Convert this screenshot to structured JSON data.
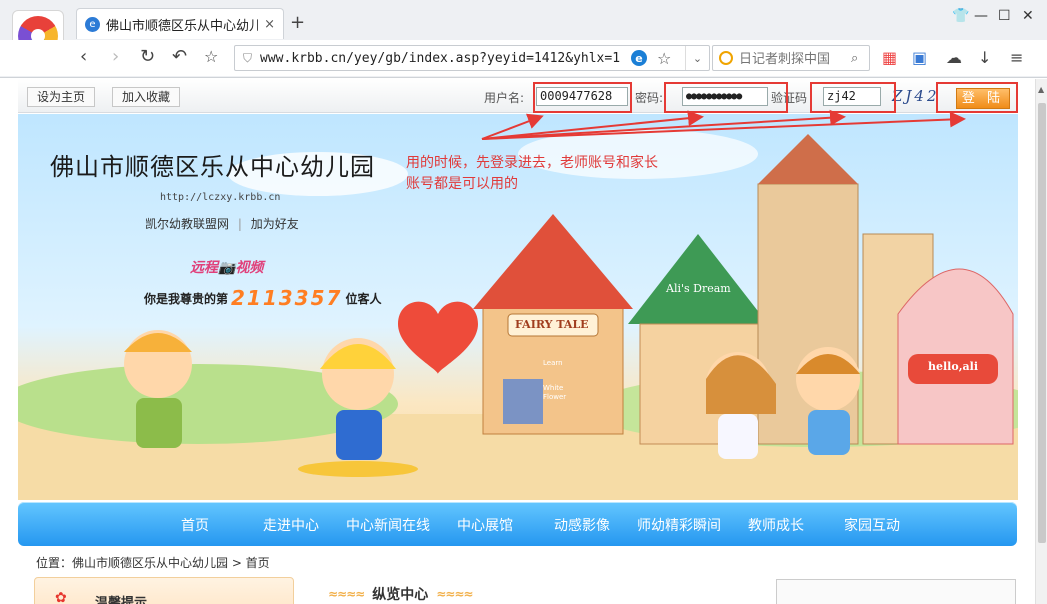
{
  "browser": {
    "tab_title": "佛山市顺德区乐从中心幼儿园",
    "tab_close": "×",
    "new_tab": "+",
    "url": "www.krbb.cn/yey/gb/index.asp?yeyid=1412&yhlx=1",
    "search_placeholder": "日记者刺探中国"
  },
  "topbar": {
    "set_home": "设为主页",
    "add_favorite": "加入收藏",
    "username_label": "用户名:",
    "username_value": "0009477628",
    "password_label": "密码:",
    "password_value": "●●●●●●●●●●●",
    "captcha_label": "验证码",
    "captcha_value": "zj42",
    "captcha_image_text": "ZJ42",
    "login_button": "登 陆"
  },
  "annotation": {
    "note": "用的时候，先登录进去，老师账号和家长账号都是可以用的"
  },
  "header": {
    "school_name": "佛山市顺德区乐从中心幼儿园",
    "school_url": "http://lczxy.krbb.cn",
    "link_alliance": "凯尔幼教联盟网",
    "link_separator": "|",
    "link_add_friend": "加为好友",
    "remote_video": "远程📷视频",
    "visitor_prefix": "你是我尊贵的第",
    "visitor_count": "2113357",
    "visitor_suffix": "位客人"
  },
  "banner_signs": {
    "fairy_tale": "FAIRY TALE",
    "alis_dream": "Ali's Dream",
    "hello_ali": "hello,ali",
    "learn": "Learn",
    "white_flower": "White Flower"
  },
  "nav": {
    "items": [
      "首页",
      "走进中心",
      "中心新闻在线",
      "中心展馆",
      "动感影像",
      "师幼精彩瞬间",
      "教师成长",
      "家园互动"
    ]
  },
  "breadcrumb": {
    "text": "位置：佛山市顺德区乐从中心幼儿园 > 首页"
  },
  "sections": {
    "tips_title": "温馨提示",
    "center_title": "纵览中心"
  },
  "colors": {
    "annotation_red": "#e53a35",
    "nav_blue": "#2597f0",
    "login_orange": "#f08c18"
  }
}
